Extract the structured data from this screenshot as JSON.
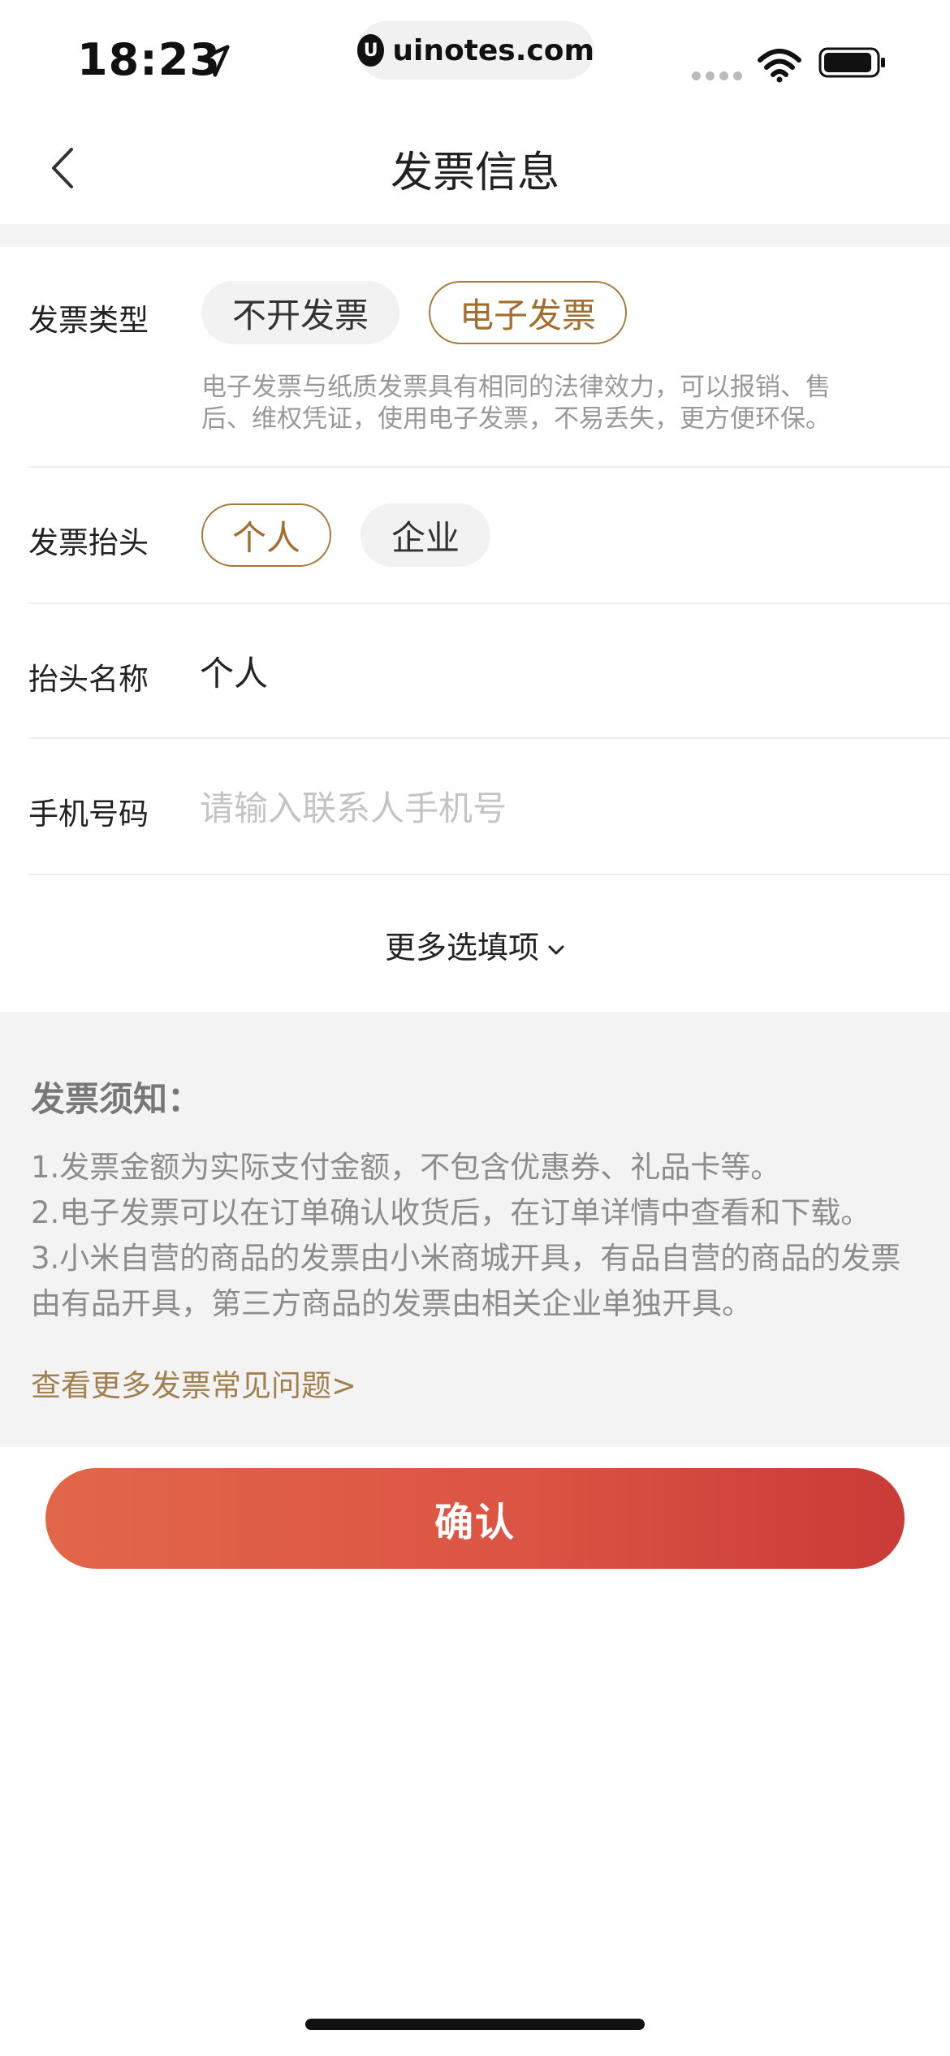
{
  "status": {
    "time": "18:23",
    "url_logo_letter": "U",
    "url": "uinotes.com"
  },
  "nav": {
    "title": "发票信息"
  },
  "invoice_type": {
    "label": "发票类型",
    "options": [
      "不开发票",
      "电子发票"
    ],
    "selected": "电子发票",
    "description_lines": [
      "电子发票与纸质发票具有相同的法律效力，可以报销、售",
      "后、维权凭证，使用电子发票，不易丢失，更方便环保。"
    ]
  },
  "invoice_header": {
    "label": "发票抬头",
    "options": [
      "个人",
      "企业"
    ],
    "selected": "个人"
  },
  "header_name": {
    "label": "抬头名称",
    "value": "个人"
  },
  "phone": {
    "label": "手机号码",
    "placeholder": "请输入联系人手机号"
  },
  "more_options": {
    "label": "更多选填项"
  },
  "notice": {
    "title": "发票须知：",
    "lines": [
      "1.发票金额为实际支付金额，不包含优惠券、礼品卡等。",
      "2.电子发票可以在订单确认收货后，在订单详情中查看和下载。",
      "3.小米自营的商品的发票由小米商城开具，有品自营的商品的发票",
      "由有品开具，第三方商品的发票由相关企业单独开具。"
    ],
    "link": "查看更多发票常见问题>"
  },
  "confirm_button": {
    "label": "确认"
  },
  "colors": {
    "accent_gold": "#a36e2d",
    "button_start": "#e2664a",
    "button_end": "#c93b37"
  }
}
